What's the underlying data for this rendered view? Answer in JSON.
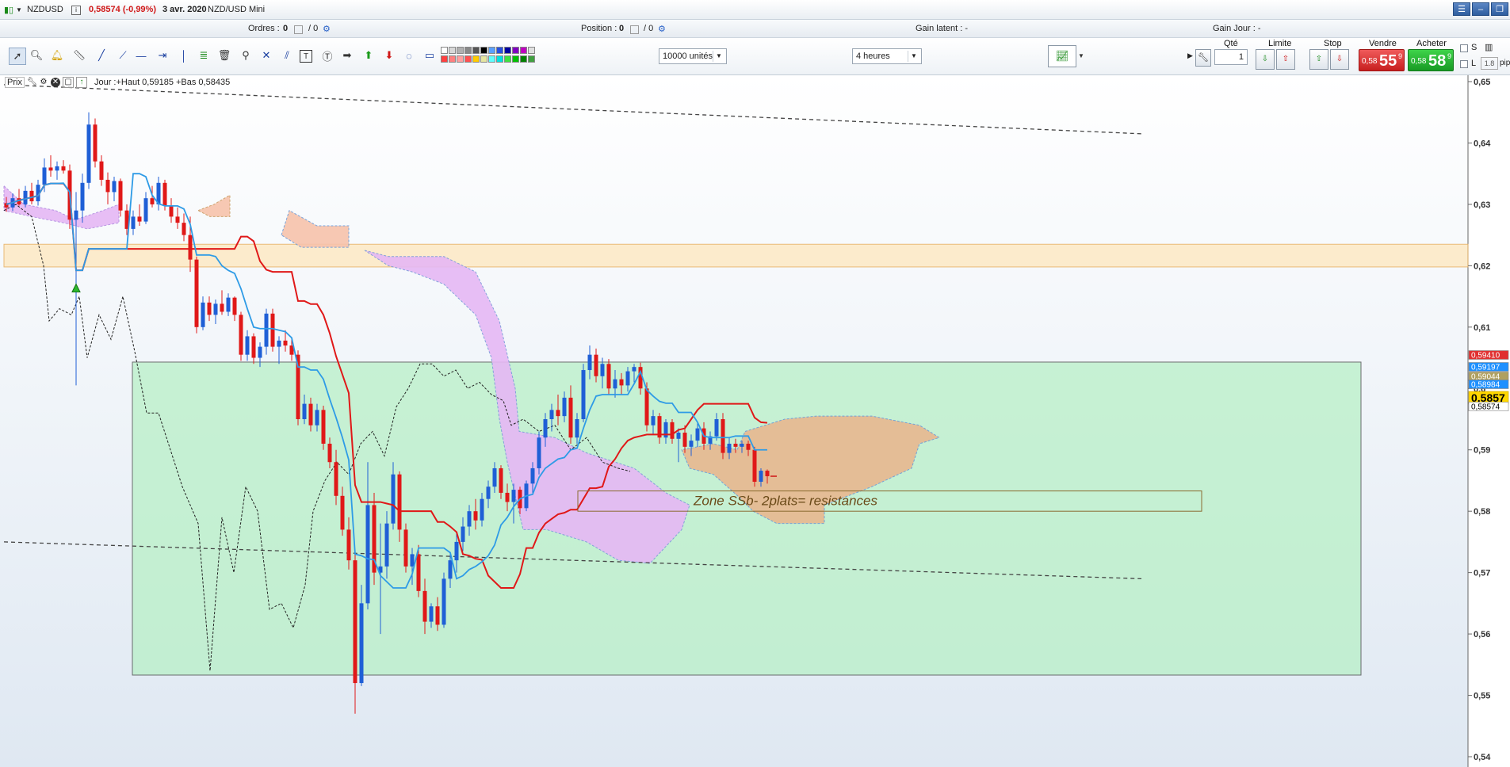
{
  "titlebar": {
    "symbol": "NZDUSD",
    "price_change": "0,58574 (-0,99%)",
    "date": "3 avr. 2020",
    "instrument": "NZD/USD Mini"
  },
  "window_buttons": {
    "menu": "☰",
    "minimize": "–",
    "restore": "❐"
  },
  "infobar": {
    "ordres_label": "Ordres :",
    "ordres_value": "0",
    "ordres_total": "/ 0",
    "position_label": "Position :",
    "position_value": "0",
    "position_total": "/ 0",
    "gain_latent": "Gain latent : -",
    "gain_jour": "Gain Jour : -"
  },
  "toolbar": {
    "units_select": "10000 unités",
    "timeframe_select": "4 heures"
  },
  "trade_panel": {
    "qty_label": "Qté",
    "qty_value": "1",
    "limite_label": "Limite",
    "stop_label": "Stop",
    "vendre_label": "Vendre",
    "acheter_label": "Acheter",
    "sell_small": "0,58",
    "sell_big": "55",
    "sell_sup": "9",
    "buy_small": "0,58",
    "buy_big": "58",
    "buy_sup": "9",
    "s_label": "S",
    "l_label": "L",
    "pip_value": "1.8",
    "pip_label": "pip"
  },
  "legend": {
    "label": "Prix",
    "text": "Jour :+Haut 0,59185 +Bas 0,58435"
  },
  "chart_data": {
    "type": "candlestick",
    "ylim": [
      0.54,
      0.65
    ],
    "y_ticks": [
      "0,65",
      "0,64",
      "0,63",
      "0,62",
      "0,61",
      "0,6",
      "0,59",
      "0,58",
      "0,57",
      "0,56",
      "0,55",
      "0,54"
    ],
    "price_tags": [
      {
        "label": "0,59410",
        "color": "#e03030"
      },
      {
        "label": "0,59197",
        "color": "#1e90ff"
      },
      {
        "label": "0,59044",
        "color": "#b0a060"
      },
      {
        "label": "0,58984",
        "color": "#1e90ff"
      },
      {
        "label": "0,5857",
        "color": "#ffd700"
      },
      {
        "label": "0,58574",
        "color": "#ffffff"
      }
    ],
    "annotation": "Zone SSb- 2plats= resistances",
    "colors": {
      "up": "#1f5fd6",
      "down": "#e01818",
      "tenkan": "#2e9be6",
      "kijun": "#e01818",
      "cloud_bull": "#e6b8f5",
      "cloud_bear": "#f7c3ac",
      "zone_green": "#b5f0c4",
      "zone_orange": "#fde9c4"
    },
    "series": [
      {
        "o": 0.6302,
        "h": 0.6312,
        "l": 0.6288,
        "c": 0.6295
      },
      {
        "o": 0.6295,
        "h": 0.6318,
        "l": 0.6289,
        "c": 0.631
      },
      {
        "o": 0.631,
        "h": 0.6325,
        "l": 0.6298,
        "c": 0.63
      },
      {
        "o": 0.63,
        "h": 0.633,
        "l": 0.6295,
        "c": 0.6322
      },
      {
        "o": 0.6322,
        "h": 0.6335,
        "l": 0.63,
        "c": 0.6305
      },
      {
        "o": 0.6305,
        "h": 0.634,
        "l": 0.6298,
        "c": 0.6332
      },
      {
        "o": 0.6332,
        "h": 0.6375,
        "l": 0.632,
        "c": 0.636
      },
      {
        "o": 0.636,
        "h": 0.638,
        "l": 0.6345,
        "c": 0.6355
      },
      {
        "o": 0.6355,
        "h": 0.637,
        "l": 0.634,
        "c": 0.6362
      },
      {
        "o": 0.6362,
        "h": 0.6372,
        "l": 0.635,
        "c": 0.6355
      },
      {
        "o": 0.6355,
        "h": 0.6365,
        "l": 0.626,
        "c": 0.6275
      },
      {
        "o": 0.6275,
        "h": 0.632,
        "l": 0.6005,
        "c": 0.629
      },
      {
        "o": 0.629,
        "h": 0.635,
        "l": 0.627,
        "c": 0.6335
      },
      {
        "o": 0.6335,
        "h": 0.645,
        "l": 0.6325,
        "c": 0.643
      },
      {
        "o": 0.643,
        "h": 0.644,
        "l": 0.636,
        "c": 0.637
      },
      {
        "o": 0.637,
        "h": 0.638,
        "l": 0.633,
        "c": 0.634
      },
      {
        "o": 0.634,
        "h": 0.6352,
        "l": 0.63,
        "c": 0.632
      },
      {
        "o": 0.632,
        "h": 0.6345,
        "l": 0.6305,
        "c": 0.6338
      },
      {
        "o": 0.6338,
        "h": 0.6342,
        "l": 0.628,
        "c": 0.629
      },
      {
        "o": 0.629,
        "h": 0.63,
        "l": 0.625,
        "c": 0.626
      },
      {
        "o": 0.626,
        "h": 0.629,
        "l": 0.625,
        "c": 0.628
      },
      {
        "o": 0.628,
        "h": 0.63,
        "l": 0.6265,
        "c": 0.6272
      },
      {
        "o": 0.6272,
        "h": 0.632,
        "l": 0.6268,
        "c": 0.631
      },
      {
        "o": 0.631,
        "h": 0.633,
        "l": 0.6295,
        "c": 0.63
      },
      {
        "o": 0.63,
        "h": 0.6345,
        "l": 0.629,
        "c": 0.6335
      },
      {
        "o": 0.6335,
        "h": 0.634,
        "l": 0.629,
        "c": 0.6298
      },
      {
        "o": 0.6298,
        "h": 0.631,
        "l": 0.627,
        "c": 0.628
      },
      {
        "o": 0.628,
        "h": 0.6295,
        "l": 0.626,
        "c": 0.627
      },
      {
        "o": 0.627,
        "h": 0.6285,
        "l": 0.624,
        "c": 0.625
      },
      {
        "o": 0.625,
        "h": 0.628,
        "l": 0.619,
        "c": 0.621
      },
      {
        "o": 0.621,
        "h": 0.6215,
        "l": 0.609,
        "c": 0.61
      },
      {
        "o": 0.61,
        "h": 0.615,
        "l": 0.6095,
        "c": 0.614
      },
      {
        "o": 0.614,
        "h": 0.615,
        "l": 0.611,
        "c": 0.612
      },
      {
        "o": 0.612,
        "h": 0.6145,
        "l": 0.6105,
        "c": 0.6138
      },
      {
        "o": 0.6138,
        "h": 0.616,
        "l": 0.612,
        "c": 0.6125
      },
      {
        "o": 0.6125,
        "h": 0.6155,
        "l": 0.6118,
        "c": 0.6148
      },
      {
        "o": 0.6148,
        "h": 0.615,
        "l": 0.611,
        "c": 0.612
      },
      {
        "o": 0.612,
        "h": 0.6125,
        "l": 0.6045,
        "c": 0.6055
      },
      {
        "o": 0.6055,
        "h": 0.6095,
        "l": 0.6045,
        "c": 0.6085
      },
      {
        "o": 0.6085,
        "h": 0.609,
        "l": 0.604,
        "c": 0.605
      },
      {
        "o": 0.605,
        "h": 0.6075,
        "l": 0.6035,
        "c": 0.6068
      },
      {
        "o": 0.6068,
        "h": 0.613,
        "l": 0.6055,
        "c": 0.6122
      },
      {
        "o": 0.6122,
        "h": 0.613,
        "l": 0.606,
        "c": 0.6068
      },
      {
        "o": 0.6068,
        "h": 0.6085,
        "l": 0.604,
        "c": 0.6078
      },
      {
        "o": 0.6078,
        "h": 0.6095,
        "l": 0.606,
        "c": 0.607
      },
      {
        "o": 0.607,
        "h": 0.608,
        "l": 0.6045,
        "c": 0.6055
      },
      {
        "o": 0.6055,
        "h": 0.6062,
        "l": 0.594,
        "c": 0.595
      },
      {
        "o": 0.595,
        "h": 0.599,
        "l": 0.5942,
        "c": 0.5975
      },
      {
        "o": 0.5975,
        "h": 0.5985,
        "l": 0.593,
        "c": 0.594
      },
      {
        "o": 0.594,
        "h": 0.5975,
        "l": 0.593,
        "c": 0.5965
      },
      {
        "o": 0.5965,
        "h": 0.5972,
        "l": 0.59,
        "c": 0.591
      },
      {
        "o": 0.591,
        "h": 0.592,
        "l": 0.587,
        "c": 0.588
      },
      {
        "o": 0.588,
        "h": 0.59,
        "l": 0.581,
        "c": 0.5825
      },
      {
        "o": 0.5825,
        "h": 0.584,
        "l": 0.576,
        "c": 0.577
      },
      {
        "o": 0.577,
        "h": 0.579,
        "l": 0.5705,
        "c": 0.572
      },
      {
        "o": 0.572,
        "h": 0.573,
        "l": 0.547,
        "c": 0.552
      },
      {
        "o": 0.552,
        "h": 0.568,
        "l": 0.5515,
        "c": 0.565
      },
      {
        "o": 0.565,
        "h": 0.588,
        "l": 0.564,
        "c": 0.581
      },
      {
        "o": 0.581,
        "h": 0.583,
        "l": 0.568,
        "c": 0.57
      },
      {
        "o": 0.57,
        "h": 0.578,
        "l": 0.56,
        "c": 0.571
      },
      {
        "o": 0.571,
        "h": 0.58,
        "l": 0.569,
        "c": 0.578
      },
      {
        "o": 0.578,
        "h": 0.588,
        "l": 0.577,
        "c": 0.586
      },
      {
        "o": 0.586,
        "h": 0.5865,
        "l": 0.575,
        "c": 0.577
      },
      {
        "o": 0.577,
        "h": 0.578,
        "l": 0.57,
        "c": 0.571
      },
      {
        "o": 0.571,
        "h": 0.574,
        "l": 0.568,
        "c": 0.573
      },
      {
        "o": 0.573,
        "h": 0.5745,
        "l": 0.566,
        "c": 0.567
      },
      {
        "o": 0.567,
        "h": 0.569,
        "l": 0.56,
        "c": 0.562
      },
      {
        "o": 0.562,
        "h": 0.565,
        "l": 0.561,
        "c": 0.5645
      },
      {
        "o": 0.5645,
        "h": 0.566,
        "l": 0.5605,
        "c": 0.5615
      },
      {
        "o": 0.5615,
        "h": 0.57,
        "l": 0.561,
        "c": 0.569
      },
      {
        "o": 0.569,
        "h": 0.573,
        "l": 0.5675,
        "c": 0.572
      },
      {
        "o": 0.572,
        "h": 0.5765,
        "l": 0.57,
        "c": 0.575
      },
      {
        "o": 0.575,
        "h": 0.579,
        "l": 0.5735,
        "c": 0.5775
      },
      {
        "o": 0.5775,
        "h": 0.581,
        "l": 0.576,
        "c": 0.58
      },
      {
        "o": 0.58,
        "h": 0.582,
        "l": 0.577,
        "c": 0.5785
      },
      {
        "o": 0.5785,
        "h": 0.583,
        "l": 0.5775,
        "c": 0.582
      },
      {
        "o": 0.582,
        "h": 0.585,
        "l": 0.5805,
        "c": 0.584
      },
      {
        "o": 0.584,
        "h": 0.588,
        "l": 0.583,
        "c": 0.587
      },
      {
        "o": 0.587,
        "h": 0.5875,
        "l": 0.582,
        "c": 0.583
      },
      {
        "o": 0.583,
        "h": 0.5845,
        "l": 0.58,
        "c": 0.5815
      },
      {
        "o": 0.5815,
        "h": 0.5845,
        "l": 0.578,
        "c": 0.5835
      },
      {
        "o": 0.5835,
        "h": 0.584,
        "l": 0.5795,
        "c": 0.5805
      },
      {
        "o": 0.5805,
        "h": 0.585,
        "l": 0.58,
        "c": 0.5845
      },
      {
        "o": 0.5845,
        "h": 0.588,
        "l": 0.583,
        "c": 0.587
      },
      {
        "o": 0.587,
        "h": 0.593,
        "l": 0.586,
        "c": 0.592
      },
      {
        "o": 0.592,
        "h": 0.596,
        "l": 0.5905,
        "c": 0.595
      },
      {
        "o": 0.595,
        "h": 0.5975,
        "l": 0.593,
        "c": 0.5965
      },
      {
        "o": 0.5965,
        "h": 0.599,
        "l": 0.594,
        "c": 0.5955
      },
      {
        "o": 0.5955,
        "h": 0.5995,
        "l": 0.5945,
        "c": 0.5985
      },
      {
        "o": 0.5985,
        "h": 0.6005,
        "l": 0.591,
        "c": 0.592
      },
      {
        "o": 0.592,
        "h": 0.596,
        "l": 0.591,
        "c": 0.595
      },
      {
        "o": 0.595,
        "h": 0.604,
        "l": 0.5945,
        "c": 0.603
      },
      {
        "o": 0.603,
        "h": 0.607,
        "l": 0.6015,
        "c": 0.6055
      },
      {
        "o": 0.6055,
        "h": 0.6065,
        "l": 0.601,
        "c": 0.602
      },
      {
        "o": 0.602,
        "h": 0.605,
        "l": 0.6,
        "c": 0.604
      },
      {
        "o": 0.604,
        "h": 0.6048,
        "l": 0.599,
        "c": 0.6
      },
      {
        "o": 0.6,
        "h": 0.603,
        "l": 0.5985,
        "c": 0.6015
      },
      {
        "o": 0.6015,
        "h": 0.6025,
        "l": 0.599,
        "c": 0.6005
      },
      {
        "o": 0.6005,
        "h": 0.6035,
        "l": 0.5995,
        "c": 0.6028
      },
      {
        "o": 0.6028,
        "h": 0.604,
        "l": 0.601,
        "c": 0.6035
      },
      {
        "o": 0.6035,
        "h": 0.6042,
        "l": 0.599,
        "c": 0.6
      },
      {
        "o": 0.6,
        "h": 0.601,
        "l": 0.593,
        "c": 0.594
      },
      {
        "o": 0.594,
        "h": 0.5965,
        "l": 0.5925,
        "c": 0.5955
      },
      {
        "o": 0.5955,
        "h": 0.596,
        "l": 0.591,
        "c": 0.592
      },
      {
        "o": 0.592,
        "h": 0.595,
        "l": 0.591,
        "c": 0.5945
      },
      {
        "o": 0.5945,
        "h": 0.595,
        "l": 0.591,
        "c": 0.5918
      },
      {
        "o": 0.5918,
        "h": 0.5935,
        "l": 0.588,
        "c": 0.5928
      },
      {
        "o": 0.5928,
        "h": 0.594,
        "l": 0.5895,
        "c": 0.5905
      },
      {
        "o": 0.5905,
        "h": 0.5925,
        "l": 0.589,
        "c": 0.5915
      },
      {
        "o": 0.5915,
        "h": 0.5945,
        "l": 0.5905,
        "c": 0.5935
      },
      {
        "o": 0.5935,
        "h": 0.5945,
        "l": 0.59,
        "c": 0.591
      },
      {
        "o": 0.591,
        "h": 0.593,
        "l": 0.59,
        "c": 0.5922
      },
      {
        "o": 0.5922,
        "h": 0.596,
        "l": 0.5915,
        "c": 0.595
      },
      {
        "o": 0.595,
        "h": 0.596,
        "l": 0.5885,
        "c": 0.5895
      },
      {
        "o": 0.5895,
        "h": 0.592,
        "l": 0.5885,
        "c": 0.591
      },
      {
        "o": 0.591,
        "h": 0.5918,
        "l": 0.5895,
        "c": 0.5905
      },
      {
        "o": 0.5905,
        "h": 0.5915,
        "l": 0.5895,
        "c": 0.591
      },
      {
        "o": 0.591,
        "h": 0.5915,
        "l": 0.589,
        "c": 0.59
      },
      {
        "o": 0.59,
        "h": 0.5905,
        "l": 0.584,
        "c": 0.5848
      },
      {
        "o": 0.5848,
        "h": 0.587,
        "l": 0.584,
        "c": 0.5866
      },
      {
        "o": 0.5866,
        "h": 0.5868,
        "l": 0.5845,
        "c": 0.5857
      }
    ]
  }
}
